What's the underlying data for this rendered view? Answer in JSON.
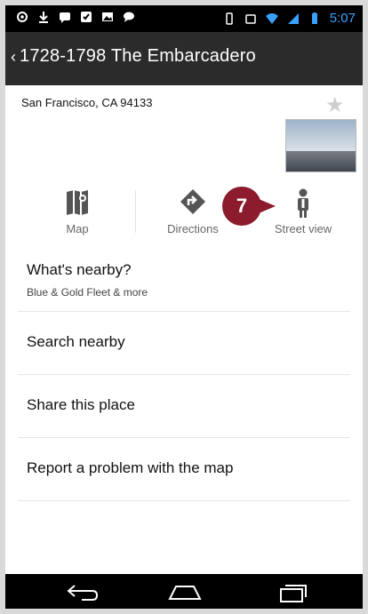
{
  "status_bar": {
    "time": "5:07",
    "left_icons": [
      "gps-icon",
      "download-icon",
      "messages-icon",
      "check-icon",
      "image-icon",
      "chat-icon"
    ],
    "right_icons": [
      "vibrate-icon",
      "rotate-icon",
      "wifi-icon",
      "signal-icon",
      "battery-icon"
    ]
  },
  "action_bar": {
    "title": "1728-1798 The Embarcadero"
  },
  "place": {
    "address": "San Francisco, CA 94133"
  },
  "actions": {
    "map_label": "Map",
    "directions_label": "Directions",
    "street_view_label": "Street view"
  },
  "callout": {
    "number": "7"
  },
  "list": {
    "items": [
      {
        "label": "What's nearby?",
        "sub": "Blue & Gold Fleet & more"
      },
      {
        "label": "Search nearby"
      },
      {
        "label": "Share this place"
      },
      {
        "label": "Report a problem with the map"
      }
    ]
  },
  "colors": {
    "callout": "#8b1b2d",
    "action_bar": "#2b2b2b"
  }
}
